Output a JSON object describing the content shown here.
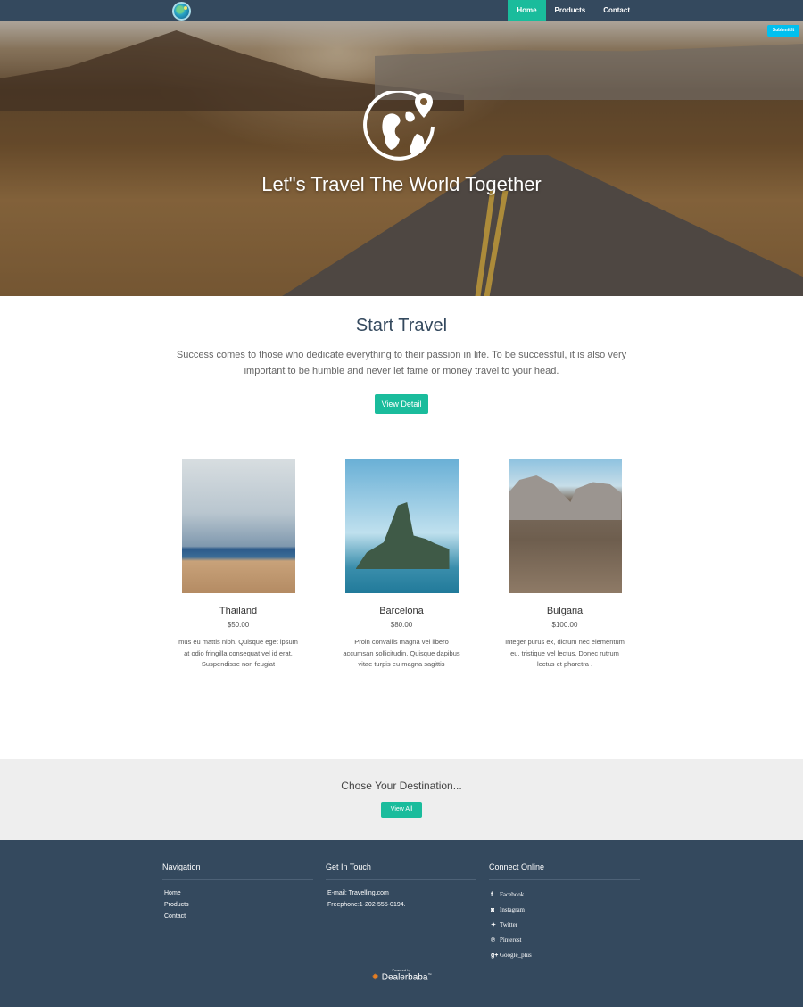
{
  "nav": {
    "logo": "globe-logo",
    "links": [
      {
        "label": "Home",
        "active": true
      },
      {
        "label": "Products",
        "active": false
      },
      {
        "label": "Contact",
        "active": false
      }
    ],
    "accent": "#1abc9c",
    "background": "#34495e"
  },
  "submit_button": "Subbmit It",
  "hero": {
    "icon": "globe-pin-icon",
    "title": "Let\"s Travel The World Together"
  },
  "intro": {
    "title": "Start Travel",
    "text": "Success comes to those who dedicate everything to their passion in life. To be successful, it is also very important to be humble and never let fame or money travel to your head.",
    "button": "View Detail"
  },
  "products": [
    {
      "name": "Thailand",
      "price": "$50.00",
      "description": "mus eu mattis nibh. Quisque eget ipsum at odio fringilla consequat vel id erat. Suspendisse non feugiat",
      "image": "beach-crowd-photo"
    },
    {
      "name": "Barcelona",
      "price": "$80.00",
      "description": "Proin convallis magna vel libero accumsan sollicitudin. Quisque dapibus vitae turpis eu magna sagittis",
      "image": "sea-rock-island-photo"
    },
    {
      "name": "Bulgaria",
      "price": "$100.00",
      "description": "Integer purus ex, dictum nec elementum eu, tristique vel lectus. Donec rutrum lectus et pharetra .",
      "image": "domed-mosque-photo"
    }
  ],
  "destination": {
    "title": "Chose Your Destination...",
    "button": "View All"
  },
  "footer": {
    "navigation": {
      "title": "Navigation",
      "links": [
        "Home",
        "Products",
        "Contact"
      ]
    },
    "contact": {
      "title": "Get In Touch",
      "email": "E-mail: Travelling.com",
      "phone": "Freephone:1-202-555-0194."
    },
    "social": {
      "title": "Connect Online",
      "links": [
        {
          "label": "Facebook",
          "icon": "f"
        },
        {
          "label": "Instagram",
          "icon": "◙"
        },
        {
          "label": "Twitter",
          "icon": "🐦"
        },
        {
          "label": "Pinterest",
          "icon": "℗"
        },
        {
          "label": "Google_plus",
          "icon": "g+"
        }
      ]
    },
    "powered_by": "Powered by",
    "brand": "Dealerbaba",
    "brand_tm": "™"
  }
}
